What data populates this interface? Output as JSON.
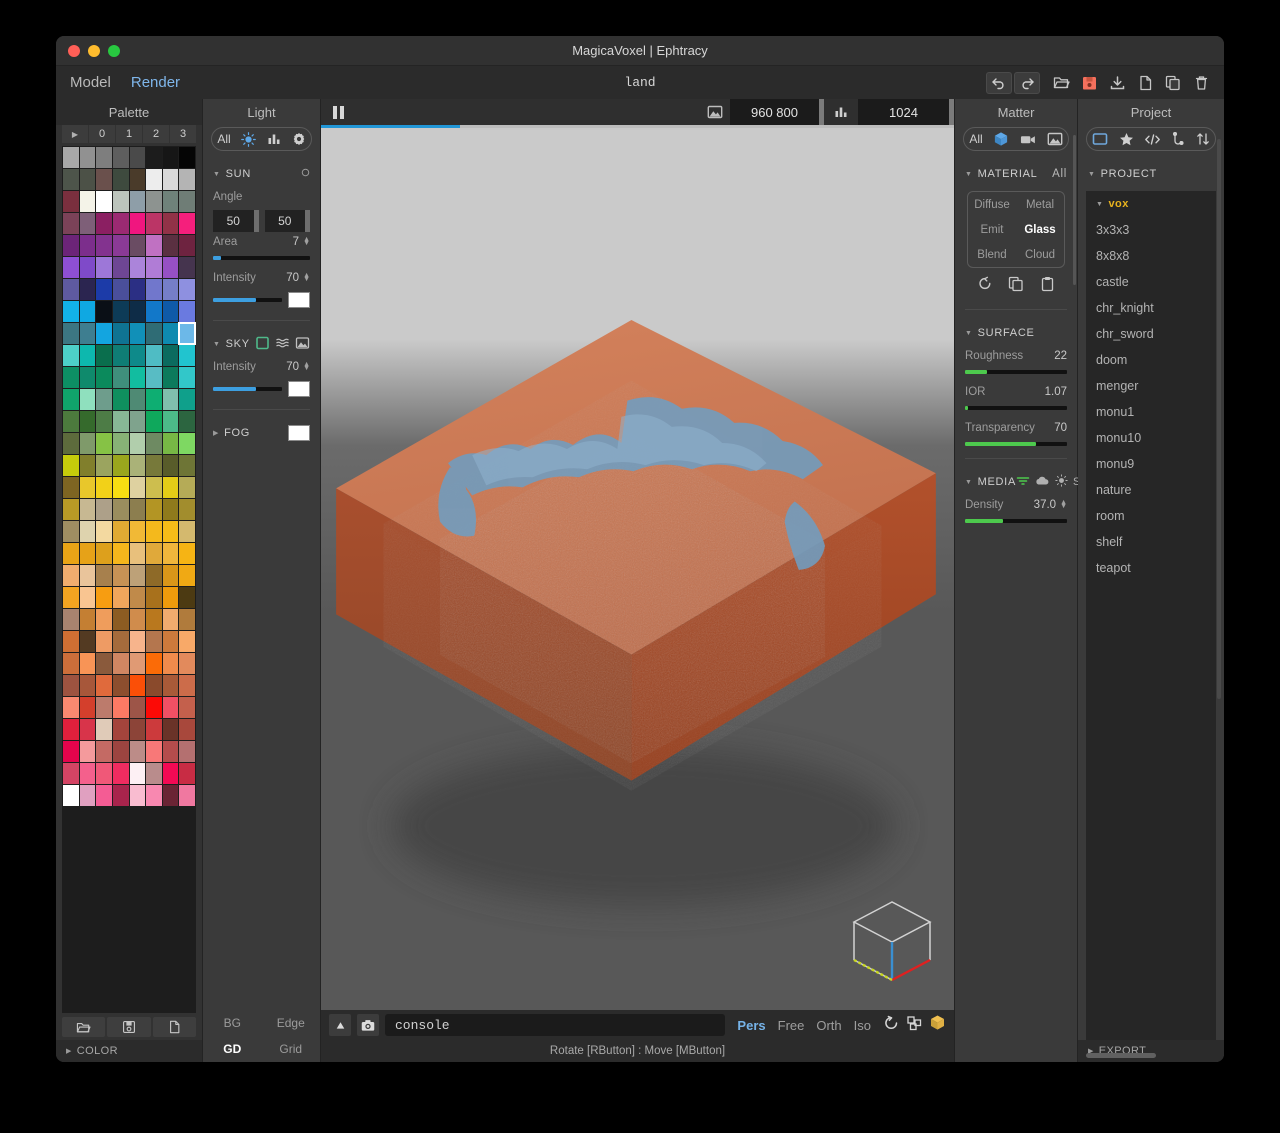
{
  "window": {
    "title": "MagicaVoxel | Ephtracy",
    "traffic": [
      "close",
      "minimize",
      "zoom"
    ]
  },
  "menu": {
    "items": [
      {
        "label": "Model",
        "active": false
      },
      {
        "label": "Render",
        "active": true
      }
    ],
    "document_title": "land",
    "toolbar": [
      {
        "name": "undo-button",
        "icon": "undo-icon",
        "boxed": true
      },
      {
        "name": "redo-button",
        "icon": "redo-icon",
        "boxed": true
      },
      {
        "name": "open-button",
        "icon": "folder-open-icon",
        "boxed": false
      },
      {
        "name": "save-button",
        "icon": "floppy-save-icon",
        "boxed": false
      },
      {
        "name": "download-button",
        "icon": "download-icon",
        "boxed": false
      },
      {
        "name": "new-button",
        "icon": "file-icon",
        "boxed": false
      },
      {
        "name": "copy-button",
        "icon": "copy-icon",
        "boxed": false
      },
      {
        "name": "delete-button",
        "icon": "trash-icon",
        "boxed": false
      }
    ]
  },
  "palette": {
    "header": "Palette",
    "page_tabs": [
      "▶",
      "0",
      "1",
      "2",
      "3"
    ],
    "footer_label": "COLOR",
    "buttons": [
      {
        "name": "palette-open-button",
        "icon": "folder-open-icon"
      },
      {
        "name": "palette-save-button",
        "icon": "floppy-save-icon"
      },
      {
        "name": "palette-new-button",
        "icon": "file-icon"
      }
    ],
    "selected_index": 71,
    "colors": [
      "#a8a8a8",
      "#919191",
      "#7e7e7e",
      "#5e5e5e",
      "#4a4a4a",
      "#1c1c1c",
      "#161616",
      "#050505",
      "#4d544a",
      "#4c5147",
      "#6a504c",
      "#3e4a3e",
      "#4a3b2a",
      "#ededed",
      "#d9d9d9",
      "#b4b4b4",
      "#7a2f3e",
      "#f4f3e8",
      "#ffffff",
      "#bcc4bc",
      "#8e9ea8",
      "#8d9390",
      "#6f827a",
      "#6f7d76",
      "#7b4258",
      "#7e5f78",
      "#8b1f62",
      "#9b2a72",
      "#f0167f",
      "#bb3566",
      "#913247",
      "#f51f7c",
      "#6c2478",
      "#7c2e8c",
      "#83338f",
      "#8a3a96",
      "#6a4c63",
      "#c071c2",
      "#5a3041",
      "#6e2340",
      "#8e4fd4",
      "#7f4ac9",
      "#9d77d8",
      "#6e4694",
      "#ab84da",
      "#b07cd6",
      "#9650c4",
      "#45344e",
      "#5e5aa0",
      "#2b2550",
      "#1c3ba8",
      "#4a4f9b",
      "#2b2f84",
      "#7177cc",
      "#757ec8",
      "#8e90e0",
      "#12b2e8",
      "#0fa8e2",
      "#0a0f16",
      "#0d3b57",
      "#0e2c47",
      "#1278c9",
      "#0f5aa8",
      "#6a7ae0",
      "#3c7682",
      "#3e7e90",
      "#13a5e0",
      "#0f7392",
      "#1190b8",
      "#2f6c75",
      "#0e8ab0",
      "#6cb8e8",
      "#4dd0c8",
      "#0db8ae",
      "#0a6e4d",
      "#0f7d75",
      "#0e8a8a",
      "#4fbcc4",
      "#0b6b5f",
      "#21c4cf",
      "#0d8f64",
      "#0f8a6c",
      "#0b8a5c",
      "#3f8f7c",
      "#12bda0",
      "#58bcc4",
      "#0c7a5c",
      "#32c7c9",
      "#10a46b",
      "#8fe0be",
      "#6e9d8c",
      "#0f8f5e",
      "#4f8a74",
      "#0eae72",
      "#80bfad",
      "#0fa08b",
      "#4c7a3d",
      "#356a2c",
      "#4d7c46",
      "#87b796",
      "#7fa38d",
      "#0fa85c",
      "#4cba89",
      "#2c6540",
      "#5d6b3c",
      "#7f9a6a",
      "#86c245",
      "#87b276",
      "#b1ceac",
      "#6e8a62",
      "#77b845",
      "#7ed862",
      "#c6cc0b",
      "#817f2c",
      "#9ba45f",
      "#9aa61d",
      "#aab278",
      "#77793a",
      "#585c2a",
      "#6e7536",
      "#7e6522",
      "#e8c72b",
      "#f2d118",
      "#f7de12",
      "#ded1a0",
      "#cdbe4e",
      "#e4cd17",
      "#b5ab57",
      "#b99a26",
      "#c7b892",
      "#ada089",
      "#9a8d5e",
      "#8c7e4f",
      "#b39524",
      "#8f7a1c",
      "#a28d2d",
      "#9f8e62",
      "#ded3ae",
      "#f3d9a0",
      "#e0aa33",
      "#f1b936",
      "#f4b91c",
      "#f6bc18",
      "#d4b96e",
      "#e9a416",
      "#e6a218",
      "#dda01c",
      "#f5b61c",
      "#e8c07c",
      "#e0a93a",
      "#f0b63c",
      "#f6b414",
      "#f0ad6e",
      "#e9c49b",
      "#a7804d",
      "#c79255",
      "#bda178",
      "#8e6a28",
      "#d99619",
      "#f0a914",
      "#f3a421",
      "#f9c591",
      "#f79d11",
      "#f0a65c",
      "#c08a4a",
      "#a8711c",
      "#ef9b0c",
      "#4c3a12",
      "#a8836f",
      "#c47f33",
      "#ef9d5c",
      "#8c5c22",
      "#d08c4c",
      "#b9781e",
      "#f0ab6e",
      "#b07b3c",
      "#cf6f33",
      "#533a22",
      "#ee9b64",
      "#a56b3c",
      "#f7b48c",
      "#b4764e",
      "#cd7a3c",
      "#f8a968",
      "#cc6e3a",
      "#f89456",
      "#8a5a3c",
      "#d08662",
      "#e09a74",
      "#fb6b07",
      "#f08b4c",
      "#e28a5c",
      "#9d5340",
      "#a7573a",
      "#e06a3c",
      "#8c4e2e",
      "#fb4f07",
      "#8a4a2c",
      "#a85a38",
      "#cc6c4a",
      "#f98970",
      "#d43f2c",
      "#bc7b6c",
      "#fc7a64",
      "#9d5548",
      "#fc0a06",
      "#f05064",
      "#c4604c",
      "#e0203c",
      "#d8344a",
      "#e0cbb8",
      "#a4443c",
      "#8c4438",
      "#cc3a3c",
      "#6a3328",
      "#a8483c",
      "#e4044c",
      "#f49a9c",
      "#c46a64",
      "#9c4440",
      "#bc8c88",
      "#f87878",
      "#b44c4c",
      "#b47070",
      "#d44464",
      "#f4608c",
      "#f05878",
      "#ef2c60",
      "#fdf0f4",
      "#b98c8c",
      "#f30a54",
      "#c82c44",
      "#ffffff",
      "#e0a0c0",
      "#f45c94",
      "#a8244c",
      "#f9bcd0",
      "#f888b0",
      "#6a2434",
      "#f078a0"
    ]
  },
  "light": {
    "header": "Light",
    "tabs": [
      {
        "label": "All",
        "icon": "all-label",
        "active": false
      },
      {
        "label": "",
        "icon": "sun-icon",
        "active": true
      },
      {
        "label": "",
        "icon": "bar-chart-icon",
        "active": false
      },
      {
        "label": "",
        "icon": "gear-icon",
        "active": false
      }
    ],
    "sun": {
      "title": "SUN",
      "expanded": true,
      "toggle_icon": "circle-toggle-icon",
      "angle_label": "Angle",
      "angle_values": [
        "50",
        "50"
      ],
      "area_label": "Area",
      "area_value": "7",
      "area_pct": 8,
      "intensity_label": "Intensity",
      "intensity_value": "70",
      "intensity_pct": 62,
      "color": "#ffffff"
    },
    "sky": {
      "title": "SKY",
      "expanded": true,
      "modes": [
        "gradient-square-icon",
        "waves-icon",
        "image-icon"
      ],
      "active_mode": 0,
      "intensity_label": "Intensity",
      "intensity_value": "70",
      "intensity_pct": 62,
      "color": "#ffffff"
    },
    "fog": {
      "title": "FOG",
      "expanded": false,
      "color": "#ffffff"
    },
    "view_toggles": [
      {
        "label": "BG",
        "on": false
      },
      {
        "label": "Edge",
        "on": false
      },
      {
        "label": "GD",
        "on": true
      },
      {
        "label": "Grid",
        "on": false
      }
    ]
  },
  "render": {
    "paused": true,
    "pause_icon": "pause-icon",
    "image_icon": "image-icon",
    "chart_icon": "bar-chart-icon",
    "resolution": "960  800",
    "samples": "1024",
    "progress_pct": 22
  },
  "viewport": {
    "sky_top_color": "#cacaca",
    "sky_mid_color": "#6b6b6b",
    "sky_bottom_color": "#585858",
    "model": {
      "name": "land",
      "terrain_color": "#c8714f",
      "terrain_dark_color": "#a04a2c",
      "water_color": "#3b9bc4",
      "water_dark_color": "#2f86b0"
    },
    "gizmo": {
      "name": "axis-cube-gizmo",
      "x_axis_color": "#e02020",
      "y_axis_color": "#c8d820",
      "z_axis_color": "#3a8fd0",
      "wire_color": "#d0d0d0"
    }
  },
  "bottom": {
    "expand_icon": "triangle-up-icon",
    "camera_icon": "camera-icon",
    "console_value": "console",
    "console_placeholder": "console",
    "view_modes": [
      {
        "label": "Pers",
        "on": true
      },
      {
        "label": "Free",
        "on": false
      },
      {
        "label": "Orth",
        "on": false
      },
      {
        "label": "Iso",
        "on": false
      }
    ],
    "view_icons": [
      {
        "name": "rotate-icon"
      },
      {
        "name": "grid-view-icon"
      },
      {
        "name": "cube-icon"
      }
    ],
    "hint": "Rotate [RButton] : Move [MButton]"
  },
  "matter": {
    "header": "Matter",
    "tabs": [
      {
        "label": "All",
        "icon": "all-label",
        "active": false
      },
      {
        "label": "",
        "icon": "cube-icon",
        "active": true
      },
      {
        "label": "",
        "icon": "video-camera-icon",
        "active": false
      },
      {
        "label": "",
        "icon": "image-icon",
        "active": false
      }
    ],
    "material": {
      "title": "MATERIAL",
      "scope": "All",
      "types": [
        {
          "label": "Diffuse",
          "on": false
        },
        {
          "label": "Metal",
          "on": false
        },
        {
          "label": "Emit",
          "on": false
        },
        {
          "label": "Glass",
          "on": true
        },
        {
          "label": "Blend",
          "on": false
        },
        {
          "label": "Cloud",
          "on": false
        }
      ],
      "actions": [
        {
          "name": "reset-material-button",
          "icon": "reset-icon"
        },
        {
          "name": "copy-material-button",
          "icon": "copy-icon"
        },
        {
          "name": "paste-material-button",
          "icon": "clipboard-icon"
        }
      ]
    },
    "surface": {
      "title": "SURFACE",
      "props": [
        {
          "label": "Roughness",
          "value": "22",
          "pct": 22
        },
        {
          "label": "IOR",
          "value": "1.07",
          "pct": 3
        },
        {
          "label": "Transparency",
          "value": "70",
          "pct": 70
        }
      ]
    },
    "media": {
      "title": "MEDIA",
      "icons": [
        {
          "name": "scatter-icon",
          "on": true
        },
        {
          "name": "cloud-icon",
          "on": false
        },
        {
          "name": "sun-icon",
          "on": false
        }
      ],
      "suffix": "S",
      "density_label": "Density",
      "density_value": "37.0",
      "density_pct": 37
    }
  },
  "project": {
    "header": "Project",
    "tabs": [
      {
        "name": "folder-icon",
        "active": true
      },
      {
        "name": "star-icon",
        "active": false
      },
      {
        "name": "code-icon",
        "active": false
      },
      {
        "name": "node-tree-icon",
        "active": false
      },
      {
        "name": "sort-icon",
        "active": false
      }
    ],
    "section_title": "PROJECT",
    "items": [
      {
        "label": "vox",
        "root": true
      },
      {
        "label": "3x3x3",
        "root": false
      },
      {
        "label": "8x8x8",
        "root": false
      },
      {
        "label": "castle",
        "root": false
      },
      {
        "label": "chr_knight",
        "root": false
      },
      {
        "label": "chr_sword",
        "root": false
      },
      {
        "label": "doom",
        "root": false
      },
      {
        "label": "menger",
        "root": false
      },
      {
        "label": "monu1",
        "root": false
      },
      {
        "label": "monu10",
        "root": false
      },
      {
        "label": "monu9",
        "root": false
      },
      {
        "label": "nature",
        "root": false
      },
      {
        "label": "room",
        "root": false
      },
      {
        "label": "shelf",
        "root": false
      },
      {
        "label": "teapot",
        "root": false
      }
    ],
    "footer_label": "EXPORT"
  }
}
